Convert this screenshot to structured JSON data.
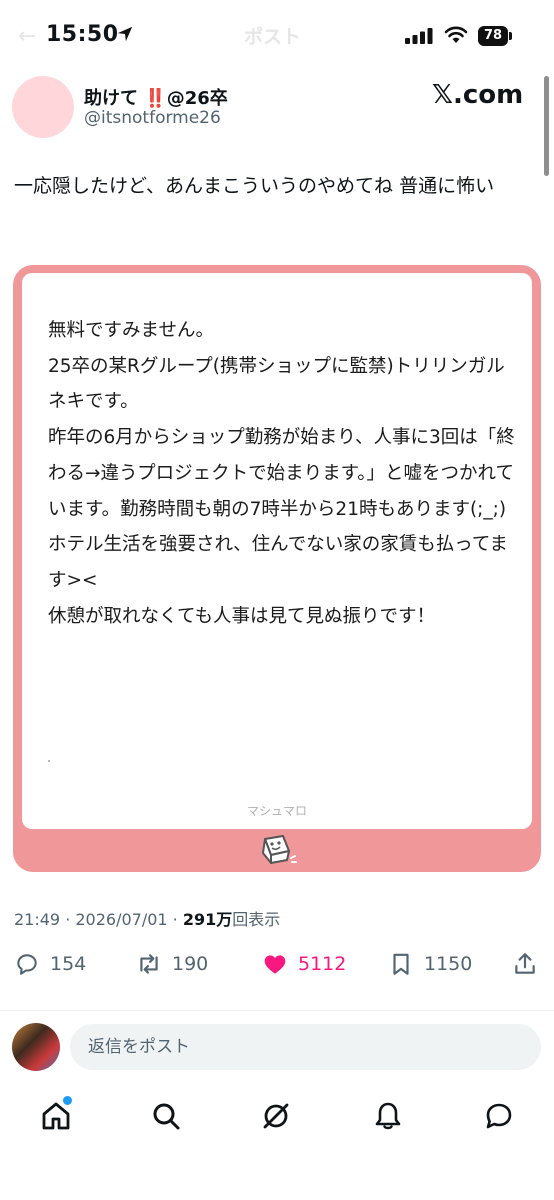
{
  "status_bar": {
    "time": "15:50",
    "battery": "78",
    "faded_title": "ポスト"
  },
  "author": {
    "name_prefix": "助けて",
    "name_bangs": "‼️",
    "name_suffix": "@26卒",
    "handle": "@itsnotforme26"
  },
  "watermark": "𝕏.com",
  "tweet": {
    "text": "一応隠したけど、あんまこういうのやめてね 普通に怖い"
  },
  "card": {
    "lines": [
      "無料ですみません。",
      "25卒の某Rグループ(携帯ショップに監禁)トリリンガルネキです。",
      "昨年の6月からショップ勤務が始まり、人事に3回は「終わる→違うプロジェクトで始まります。」と嘘をつかれています。勤務時間も朝の7時半から21時もあります(;_;)",
      "ホテル生活を強要され、住んでない家の家賃も払ってます><",
      "休憩が取れなくても人事は見て見ぬ振りです！"
    ],
    "footer": "マシュマロ"
  },
  "meta": {
    "timestamp": "21:49 · 2026/07/01 · ",
    "views_count": "291万",
    "views_label": "回表示"
  },
  "actions": {
    "replies": "154",
    "reposts": "190",
    "likes": "5112",
    "bookmarks": "1150"
  },
  "reply_bar": {
    "placeholder": "返信をポスト"
  },
  "colors": {
    "card_border": "#f09799",
    "like": "#f91880",
    "accent": "#1d9bf0"
  }
}
